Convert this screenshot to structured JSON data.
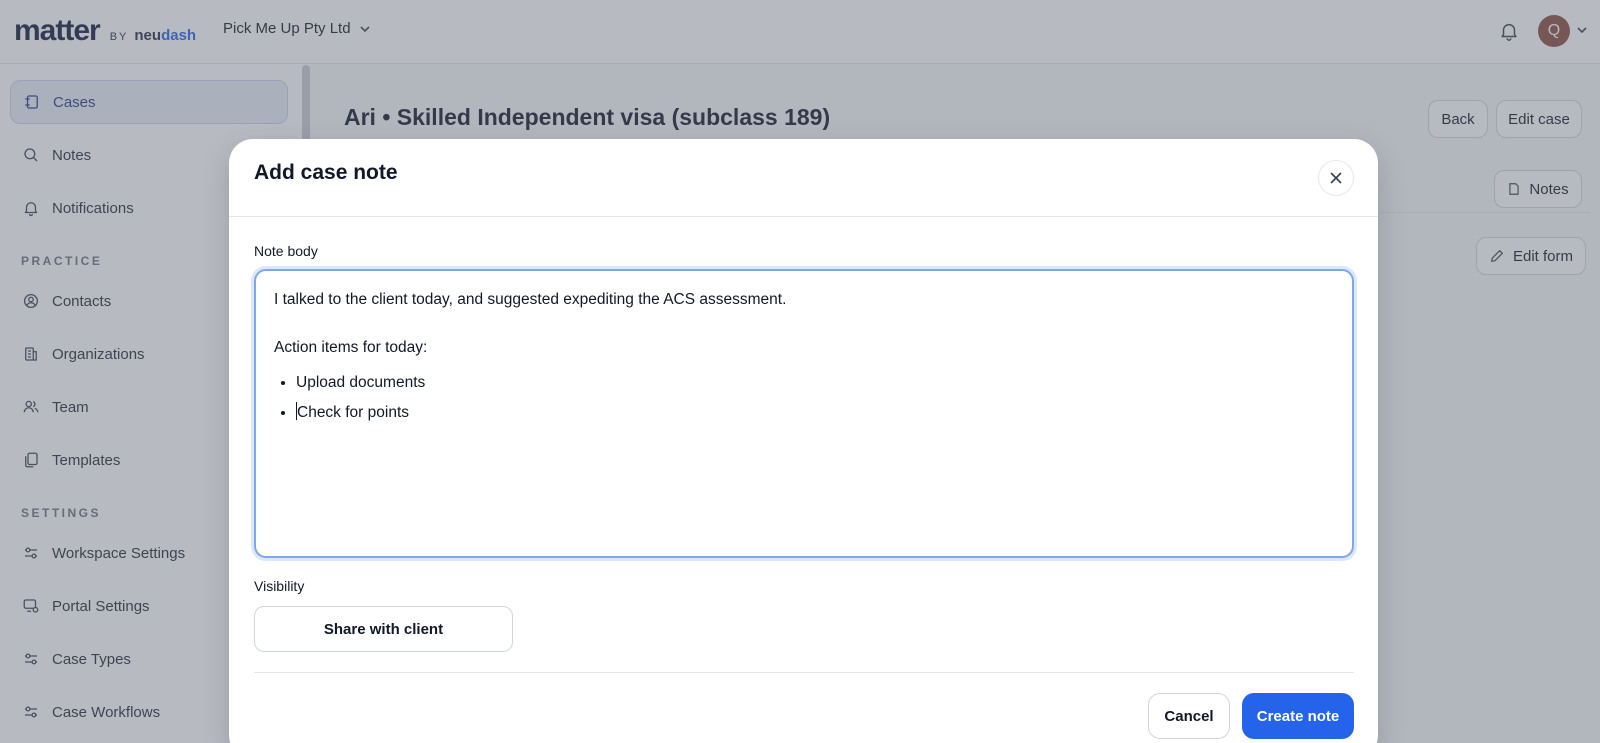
{
  "header": {
    "logo_main": "matter",
    "logo_by": "BY",
    "logo_brand_part1": "neu",
    "logo_brand_part2": "dash",
    "org_name": "Pick Me Up Pty Ltd",
    "avatar_initial": "Q"
  },
  "sidebar": {
    "items": [
      {
        "label": "Cases",
        "icon": "cases-icon",
        "active": true
      },
      {
        "label": "Notes",
        "icon": "search-icon"
      },
      {
        "label": "Notifications",
        "icon": "bell-icon"
      },
      {
        "label": "Contacts",
        "icon": "user-circle-icon"
      },
      {
        "label": "Organizations",
        "icon": "building-icon"
      },
      {
        "label": "Team",
        "icon": "users-icon"
      },
      {
        "label": "Templates",
        "icon": "copy-icon"
      },
      {
        "label": "Workspace Settings",
        "icon": "sliders-icon"
      },
      {
        "label": "Portal Settings",
        "icon": "monitor-settings-icon"
      },
      {
        "label": "Case Types",
        "icon": "sliders-icon"
      },
      {
        "label": "Case Workflows",
        "icon": "sliders-icon"
      }
    ],
    "sections": {
      "practice": "PRACTICE",
      "settings": "SETTINGS"
    }
  },
  "page": {
    "title": "Ari • Skilled Independent visa (subclass 189)",
    "back_label": "Back",
    "edit_case_label": "Edit case",
    "notes_label": "Notes",
    "edit_form_label": "Edit form"
  },
  "modal": {
    "title": "Add case note",
    "note_body_label": "Note body",
    "note_paragraph_1": "I talked to the client today, and suggested expediting the ACS assessment.",
    "note_paragraph_2": "Action items for today:",
    "note_list": [
      "Upload documents",
      "Check for points"
    ],
    "visibility_label": "Visibility",
    "share_label": "Share with client",
    "cancel_label": "Cancel",
    "create_label": "Create note"
  },
  "colors": {
    "accent": "#2563eb",
    "active_nav_bg": "#e8eef9",
    "overlay": "rgba(95,102,115,0.45)"
  }
}
